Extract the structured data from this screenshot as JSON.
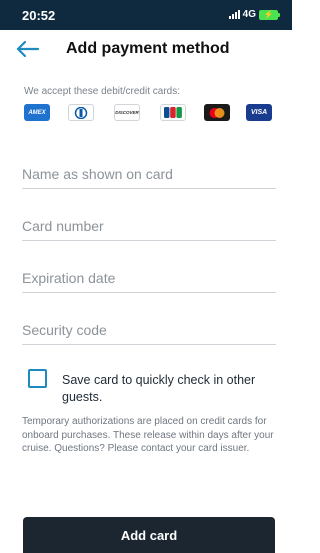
{
  "status_bar": {
    "time": "20:52",
    "network": "4G"
  },
  "header": {
    "title": "Add payment method",
    "back_icon": "arrow-left-icon"
  },
  "accepted_cards": {
    "label": "We accept these debit/credit cards:",
    "cards": [
      "AMEX",
      "DINERS",
      "DISCOVER",
      "JCB",
      "MASTERCARD",
      "VISA"
    ]
  },
  "form": {
    "name_placeholder": "Name as shown on card",
    "number_placeholder": "Card number",
    "expiration_placeholder": "Expiration date",
    "security_placeholder": "Security code",
    "name_value": "",
    "number_value": "",
    "expiration_value": "",
    "security_value": ""
  },
  "save_card": {
    "label": "Save card to quickly check in other guests.",
    "checked": false
  },
  "note": "Temporary authorizations are placed on credit cards for onboard purchases. These release within days after your cruise. Questions? Please contact your card issuer.",
  "submit": {
    "label": "Add card"
  },
  "colors": {
    "status_bar": "#0f2a3f",
    "accent": "#1f8ac0",
    "button": "#1c2631",
    "battery": "#49e34f"
  }
}
